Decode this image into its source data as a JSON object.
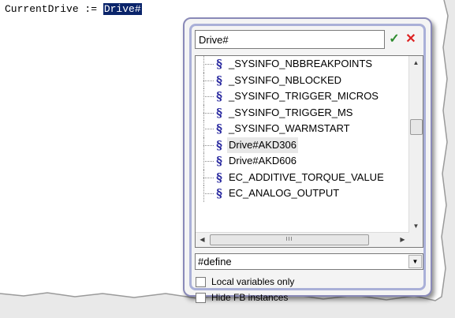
{
  "editor": {
    "code_prefix": "CurrentDrive := ",
    "code_selected": "Drive#"
  },
  "popup": {
    "search_value": "Drive#",
    "ok_label": "✓",
    "cancel_label": "✕",
    "tree_items": [
      {
        "label": "_SYSINFO_NBBREAKPOINTS",
        "icon": "section-sign-icon"
      },
      {
        "label": "_SYSINFO_NBLOCKED",
        "icon": "section-sign-icon"
      },
      {
        "label": "_SYSINFO_TRIGGER_MICROS",
        "icon": "section-sign-icon"
      },
      {
        "label": "_SYSINFO_TRIGGER_MS",
        "icon": "section-sign-icon"
      },
      {
        "label": "_SYSINFO_WARMSTART",
        "icon": "section-sign-icon"
      },
      {
        "label": "Drive#AKD306",
        "icon": "section-sign-icon"
      },
      {
        "label": "Drive#AKD606",
        "icon": "section-sign-icon"
      },
      {
        "label": "EC_ADDITIVE_TORQUE_VALUE",
        "icon": "section-sign-icon"
      },
      {
        "label": "EC_ANALOG_OUTPUT",
        "icon": "section-sign-icon"
      }
    ],
    "highlighted_index": 5,
    "scroll_h_thumb_text": "III",
    "type_filter": "#define",
    "local_vars_label": "Local variables only",
    "local_vars_checked": false,
    "hide_fb_label": "Hide FB instances",
    "hide_fb_checked": false,
    "colors": {
      "selection": "#0a246a",
      "icon": "#2a2aa0",
      "ok": "#2e8b2e",
      "cancel": "#dd2222",
      "popup_border": "#aab0d8"
    }
  }
}
